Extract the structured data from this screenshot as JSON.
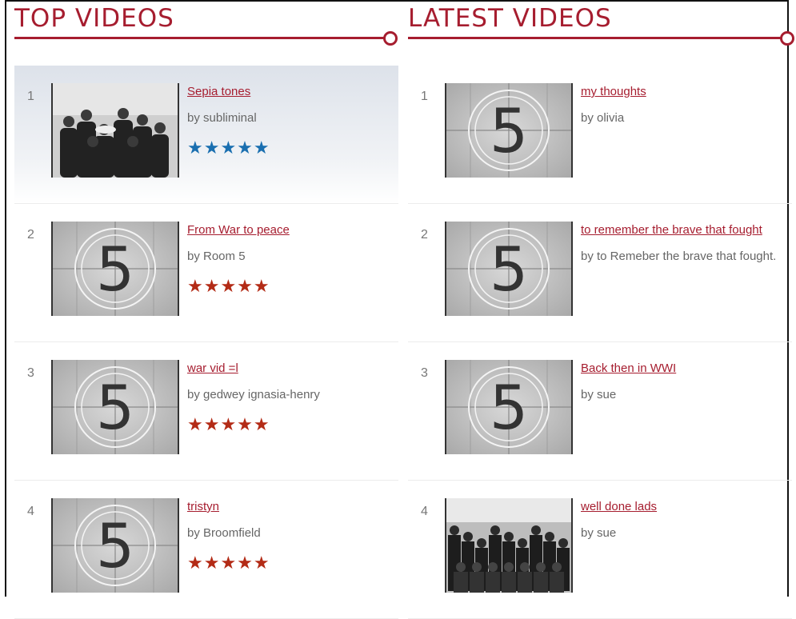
{
  "top_videos": {
    "heading": "TOP VIDEOS",
    "items": [
      {
        "rank": "1",
        "title": "Sepia tones",
        "byline": "by subliminal",
        "rating": 5,
        "thumb": "photo-group",
        "star_color": "#1a6fb0"
      },
      {
        "rank": "2",
        "title": "From War to peace",
        "byline": "by Room 5",
        "rating": 5,
        "thumb": "countdown-5",
        "star_color": "#b32b16"
      },
      {
        "rank": "3",
        "title": "war vid =l",
        "byline": "by gedwey ignasia-henry",
        "rating": 5,
        "thumb": "countdown-5",
        "star_color": "#b32b16"
      },
      {
        "rank": "4",
        "title": "tristyn",
        "byline": "by Broomfield",
        "rating": 5,
        "thumb": "countdown-5",
        "star_color": "#b32b16"
      }
    ]
  },
  "latest_videos": {
    "heading": "LATEST VIDEOS",
    "items": [
      {
        "rank": "1",
        "title": "my thoughts",
        "byline": "by olivia",
        "thumb": "countdown-5"
      },
      {
        "rank": "2",
        "title": "to remember the brave that fought",
        "byline": "by to Remeber the brave that fought.",
        "thumb": "countdown-5"
      },
      {
        "rank": "3",
        "title": "Back then in WWI",
        "byline": "by sue",
        "thumb": "countdown-5"
      },
      {
        "rank": "4",
        "title": "well done lads",
        "byline": "by sue",
        "thumb": "photo-soldiers"
      }
    ]
  },
  "colors": {
    "accent": "#a61d2f",
    "star_blue": "#1a6fb0",
    "star_red": "#b32b16"
  },
  "star_glyph": "★"
}
